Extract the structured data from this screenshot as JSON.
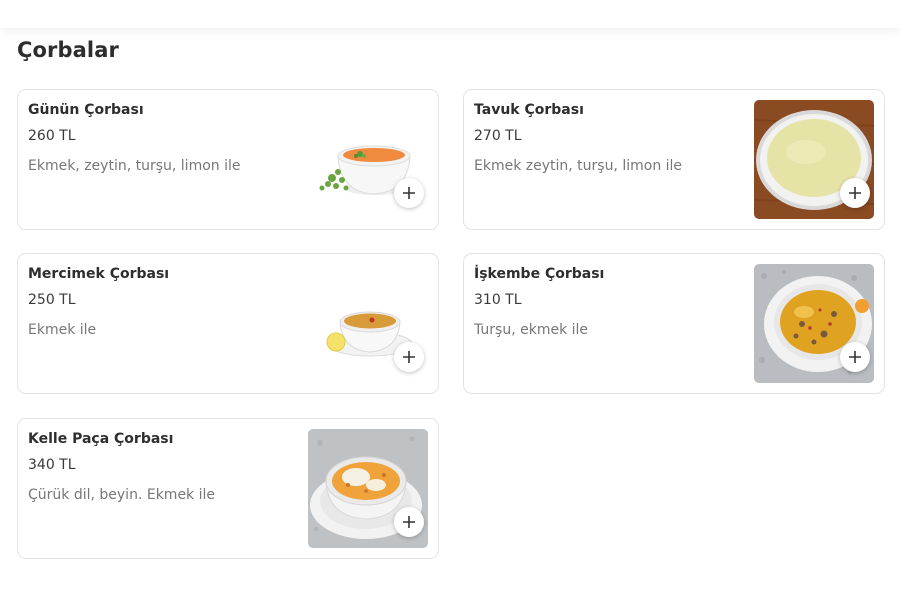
{
  "section": {
    "title": "Çorbalar"
  },
  "items": [
    {
      "name": "Günün Çorbası",
      "price": "260 TL",
      "description": "Ekmek, zeytin, turşu, limon ile",
      "image_icon": "tomato-soup-bowl-icon"
    },
    {
      "name": "Tavuk Çorbası",
      "price": "270 TL",
      "description": "Ekmek zeytin, turşu, limon ile",
      "image_icon": "chicken-soup-plate-icon"
    },
    {
      "name": "Mercimek Çorbası",
      "price": "250 TL",
      "description": "Ekmek ile",
      "image_icon": "lentil-soup-bowl-icon"
    },
    {
      "name": "İşkembe Çorbası",
      "price": "310 TL",
      "description": "Turşu, ekmek ile",
      "image_icon": "tripe-soup-bowl-icon"
    },
    {
      "name": "Kelle Paça Çorbası",
      "price": "340 TL",
      "description": "Çürük dil, beyin. Ekmek ile",
      "image_icon": "head-trotter-soup-bowl-icon"
    }
  ],
  "colors": {
    "border": "#e3e3e3",
    "title": "#2d2d2d",
    "description": "#777777"
  }
}
